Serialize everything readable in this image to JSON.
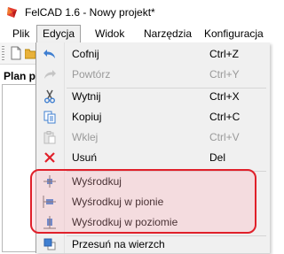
{
  "window": {
    "title": "FelCAD 1.6 - Nowy projekt*"
  },
  "menubar": {
    "items": [
      "Plik",
      "Edycja",
      "Widok",
      "Narzędzia",
      "Konfiguracja"
    ]
  },
  "left_panel": {
    "title": "Plan po"
  },
  "edit_menu": {
    "items": [
      {
        "label": "Cofnij",
        "shortcut": "Ctrl+Z",
        "icon": "undo-icon",
        "enabled": true
      },
      {
        "label": "Powtórz",
        "shortcut": "Ctrl+Y",
        "icon": "redo-icon",
        "enabled": false
      },
      {
        "label": "Wytnij",
        "shortcut": "Ctrl+X",
        "icon": "cut-icon",
        "enabled": true
      },
      {
        "label": "Kopiuj",
        "shortcut": "Ctrl+C",
        "icon": "copy-icon",
        "enabled": true
      },
      {
        "label": "Wklej",
        "shortcut": "Ctrl+V",
        "icon": "paste-icon",
        "enabled": false
      },
      {
        "label": "Usuń",
        "shortcut": "Del",
        "icon": "delete-icon",
        "enabled": true
      },
      {
        "label": "Wyśrodkuj",
        "shortcut": "",
        "icon": "center-icon",
        "enabled": true
      },
      {
        "label": "Wyśrodkuj w pionie",
        "shortcut": "",
        "icon": "center-vertical-icon",
        "enabled": true
      },
      {
        "label": "Wyśrodkuj w poziomie",
        "shortcut": "",
        "icon": "center-horizontal-icon",
        "enabled": true
      },
      {
        "label": "Przesuń na wierzch",
        "shortcut": "",
        "icon": "bring-to-front-icon",
        "enabled": true
      }
    ]
  },
  "colors": {
    "highlight_border": "#e0202a",
    "disabled_text": "#9a9a9a",
    "menu_background": "#f0f0f0"
  }
}
